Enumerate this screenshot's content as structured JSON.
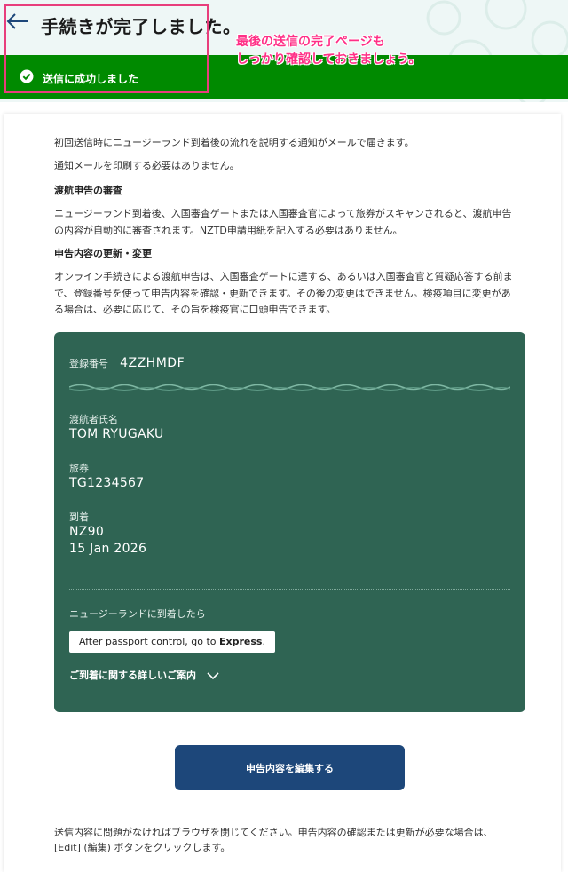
{
  "header": {
    "title": "手続きが完了しました。",
    "success_message": "送信に成功しました"
  },
  "annotation": {
    "line1": "最後の送信の完了ページも",
    "line2": "しっかり確認しておきましょう。"
  },
  "content": {
    "intro1": "初回送信時にニュージーランド到着後の流れを説明する通知がメールで届きます。",
    "intro2": "通知メールを印刷する必要はありません。",
    "section1_heading": "渡航申告の審査",
    "section1_line1": "ニュージーランド到着後、入国審査ゲートまたは入国審査官によって旅券がスキャンされると、渡航申告",
    "section1_line2": "の内容が自動的に審査されます。NZTD申請用紙を記入する必要はありません。",
    "section2_heading": "申告内容の更新・変更",
    "section2_line1": "オンライン手続きによる渡航申告は、入国審査ゲートに達する、あるいは入国審査官と質疑応答する前ま",
    "section2_line2": "で、登録番号を使って申告内容を確認・更新できます。その後の変更はできません。検疫項目に変更があ",
    "section2_line3": "る場合は、必要に応じて、その旨を検疫官に口頭申告できます。",
    "footer_line1": "送信内容に問題がなければブラウザを閉じてください。申告内容の確認または更新が必要な場合は、",
    "footer_line2": "[Edit] (編集) ボタンをクリックします。"
  },
  "card": {
    "reg_label": "登録番号",
    "reg_number": "4ZZHMDF",
    "traveller_label": "渡航者氏名",
    "traveller_name": "TOM RYUGAKU",
    "passport_label": "旅券",
    "passport_number": "TG1234567",
    "arrival_label": "到着",
    "flight": "NZ90",
    "arrival_date": "15 Jan 2026",
    "on_arrival_label": "ニュージーランドに到着したら",
    "instruction_prefix": "After passport control, go to ",
    "instruction_bold": "Express",
    "instruction_suffix": ".",
    "details_link": "ご到着に関する詳しいご案内"
  },
  "actions": {
    "edit_button": "申告内容を編集する"
  },
  "colors": {
    "success_green": "#008a00",
    "card_green": "#2f6453",
    "button_navy": "#1d477a",
    "annotation_pink": "#ff2f86",
    "highlight_border": "#e83e7c"
  },
  "icons": {
    "back": "left-arrow-icon",
    "success": "check-circle-icon",
    "expand": "chevron-down-icon"
  }
}
